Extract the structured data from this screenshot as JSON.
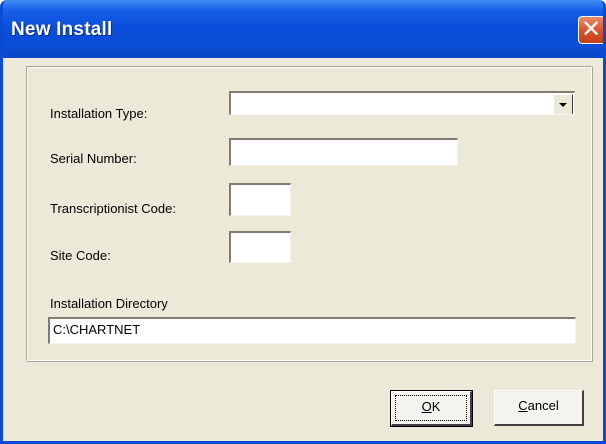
{
  "window": {
    "title": "New Install",
    "close_glyph": "✕"
  },
  "form": {
    "installation_type": {
      "label": "Installation Type:",
      "value": ""
    },
    "serial_number": {
      "label": "Serial Number:",
      "value": ""
    },
    "transcriptionist_code": {
      "label": "Transcriptionist Code:",
      "value": ""
    },
    "site_code": {
      "label": "Site Code:",
      "value": ""
    },
    "installation_directory": {
      "label": "Installation Directory",
      "value": "C:\\CHARTNET"
    }
  },
  "buttons": {
    "ok": {
      "mnemonic": "O",
      "rest": "K"
    },
    "cancel": {
      "mnemonic": "C",
      "rest": "ancel"
    }
  },
  "colors": {
    "titlebar": "#0a4fdc",
    "dialog_background": "#ece9d8",
    "close_button": "#d9552d"
  }
}
